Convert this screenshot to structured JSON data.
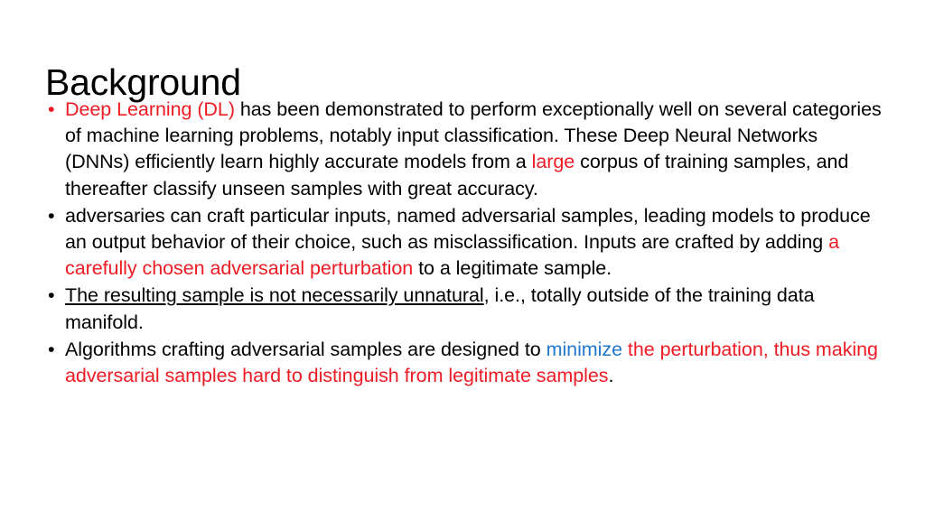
{
  "slide": {
    "title": "Background",
    "background_color": "#FFFFFF",
    "colors": {
      "red": "#ED1B24",
      "blue": "#2077CC",
      "black": "#000000"
    },
    "bullets": [
      {
        "marker": "•",
        "marker_color": "red",
        "runs": [
          {
            "text": "Deep Learning (DL)",
            "color": "red",
            "underline": false
          },
          {
            "text": " has been demonstrated to perform exceptionally well on several categories of machine learning problems, notably input classification. These Deep Neural Networks (DNNs) efficiently learn highly accurate models from a ",
            "color": "black",
            "underline": false
          },
          {
            "text": "large",
            "color": "red",
            "underline": false
          },
          {
            "text": " corpus of training samples, and thereafter classify unseen samples with great accuracy.",
            "color": "black",
            "underline": false
          }
        ]
      },
      {
        "marker": "•",
        "marker_color": "black",
        "runs": [
          {
            "text": "adversaries can craft particular inputs, named adversarial samples, leading models to produce an output behavior of their choice, such as misclassification. Inputs are crafted by adding ",
            "color": "black",
            "underline": false
          },
          {
            "text": "a carefully chosen adversarial perturbation",
            "color": "red",
            "underline": false
          },
          {
            "text": " to a legitimate sample.",
            "color": "black",
            "underline": false
          }
        ]
      },
      {
        "marker": "•",
        "marker_color": "black",
        "runs": [
          {
            "text": "The resulting sample is not necessarily unnatural",
            "color": "black",
            "underline": true
          },
          {
            "text": ", i.e., totally outside of the training data manifold.",
            "color": "black",
            "underline": false
          }
        ]
      },
      {
        "marker": "•",
        "marker_color": "black",
        "runs": [
          {
            "text": "Algorithms crafting adversarial samples are designed to ",
            "color": "black",
            "underline": false
          },
          {
            "text": "minimize",
            "color": "blue",
            "underline": false
          },
          {
            "text": " the perturbation, thus making adversarial samples hard to distinguish from legitimate samples",
            "color": "red",
            "underline": false
          },
          {
            "text": ".",
            "color": "black",
            "underline": false
          }
        ]
      }
    ]
  }
}
